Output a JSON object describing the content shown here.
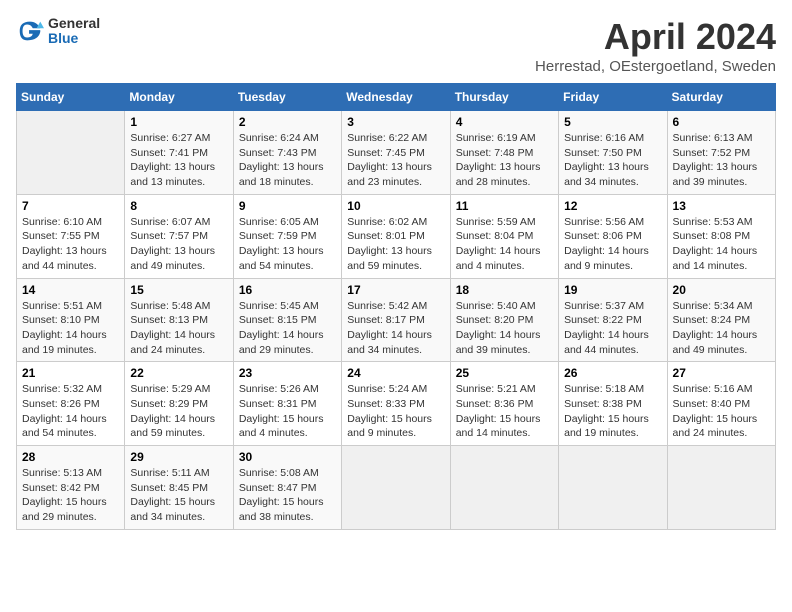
{
  "header": {
    "logo_general": "General",
    "logo_blue": "Blue",
    "title": "April 2024",
    "subtitle": "Herrestad, OEstergoetland, Sweden"
  },
  "columns": [
    "Sunday",
    "Monday",
    "Tuesday",
    "Wednesday",
    "Thursday",
    "Friday",
    "Saturday"
  ],
  "weeks": [
    [
      {
        "day": "",
        "info": ""
      },
      {
        "day": "1",
        "info": "Sunrise: 6:27 AM\nSunset: 7:41 PM\nDaylight: 13 hours\nand 13 minutes."
      },
      {
        "day": "2",
        "info": "Sunrise: 6:24 AM\nSunset: 7:43 PM\nDaylight: 13 hours\nand 18 minutes."
      },
      {
        "day": "3",
        "info": "Sunrise: 6:22 AM\nSunset: 7:45 PM\nDaylight: 13 hours\nand 23 minutes."
      },
      {
        "day": "4",
        "info": "Sunrise: 6:19 AM\nSunset: 7:48 PM\nDaylight: 13 hours\nand 28 minutes."
      },
      {
        "day": "5",
        "info": "Sunrise: 6:16 AM\nSunset: 7:50 PM\nDaylight: 13 hours\nand 34 minutes."
      },
      {
        "day": "6",
        "info": "Sunrise: 6:13 AM\nSunset: 7:52 PM\nDaylight: 13 hours\nand 39 minutes."
      }
    ],
    [
      {
        "day": "7",
        "info": "Sunrise: 6:10 AM\nSunset: 7:55 PM\nDaylight: 13 hours\nand 44 minutes."
      },
      {
        "day": "8",
        "info": "Sunrise: 6:07 AM\nSunset: 7:57 PM\nDaylight: 13 hours\nand 49 minutes."
      },
      {
        "day": "9",
        "info": "Sunrise: 6:05 AM\nSunset: 7:59 PM\nDaylight: 13 hours\nand 54 minutes."
      },
      {
        "day": "10",
        "info": "Sunrise: 6:02 AM\nSunset: 8:01 PM\nDaylight: 13 hours\nand 59 minutes."
      },
      {
        "day": "11",
        "info": "Sunrise: 5:59 AM\nSunset: 8:04 PM\nDaylight: 14 hours\nand 4 minutes."
      },
      {
        "day": "12",
        "info": "Sunrise: 5:56 AM\nSunset: 8:06 PM\nDaylight: 14 hours\nand 9 minutes."
      },
      {
        "day": "13",
        "info": "Sunrise: 5:53 AM\nSunset: 8:08 PM\nDaylight: 14 hours\nand 14 minutes."
      }
    ],
    [
      {
        "day": "14",
        "info": "Sunrise: 5:51 AM\nSunset: 8:10 PM\nDaylight: 14 hours\nand 19 minutes."
      },
      {
        "day": "15",
        "info": "Sunrise: 5:48 AM\nSunset: 8:13 PM\nDaylight: 14 hours\nand 24 minutes."
      },
      {
        "day": "16",
        "info": "Sunrise: 5:45 AM\nSunset: 8:15 PM\nDaylight: 14 hours\nand 29 minutes."
      },
      {
        "day": "17",
        "info": "Sunrise: 5:42 AM\nSunset: 8:17 PM\nDaylight: 14 hours\nand 34 minutes."
      },
      {
        "day": "18",
        "info": "Sunrise: 5:40 AM\nSunset: 8:20 PM\nDaylight: 14 hours\nand 39 minutes."
      },
      {
        "day": "19",
        "info": "Sunrise: 5:37 AM\nSunset: 8:22 PM\nDaylight: 14 hours\nand 44 minutes."
      },
      {
        "day": "20",
        "info": "Sunrise: 5:34 AM\nSunset: 8:24 PM\nDaylight: 14 hours\nand 49 minutes."
      }
    ],
    [
      {
        "day": "21",
        "info": "Sunrise: 5:32 AM\nSunset: 8:26 PM\nDaylight: 14 hours\nand 54 minutes."
      },
      {
        "day": "22",
        "info": "Sunrise: 5:29 AM\nSunset: 8:29 PM\nDaylight: 14 hours\nand 59 minutes."
      },
      {
        "day": "23",
        "info": "Sunrise: 5:26 AM\nSunset: 8:31 PM\nDaylight: 15 hours\nand 4 minutes."
      },
      {
        "day": "24",
        "info": "Sunrise: 5:24 AM\nSunset: 8:33 PM\nDaylight: 15 hours\nand 9 minutes."
      },
      {
        "day": "25",
        "info": "Sunrise: 5:21 AM\nSunset: 8:36 PM\nDaylight: 15 hours\nand 14 minutes."
      },
      {
        "day": "26",
        "info": "Sunrise: 5:18 AM\nSunset: 8:38 PM\nDaylight: 15 hours\nand 19 minutes."
      },
      {
        "day": "27",
        "info": "Sunrise: 5:16 AM\nSunset: 8:40 PM\nDaylight: 15 hours\nand 24 minutes."
      }
    ],
    [
      {
        "day": "28",
        "info": "Sunrise: 5:13 AM\nSunset: 8:42 PM\nDaylight: 15 hours\nand 29 minutes."
      },
      {
        "day": "29",
        "info": "Sunrise: 5:11 AM\nSunset: 8:45 PM\nDaylight: 15 hours\nand 34 minutes."
      },
      {
        "day": "30",
        "info": "Sunrise: 5:08 AM\nSunset: 8:47 PM\nDaylight: 15 hours\nand 38 minutes."
      },
      {
        "day": "",
        "info": ""
      },
      {
        "day": "",
        "info": ""
      },
      {
        "day": "",
        "info": ""
      },
      {
        "day": "",
        "info": ""
      }
    ]
  ]
}
